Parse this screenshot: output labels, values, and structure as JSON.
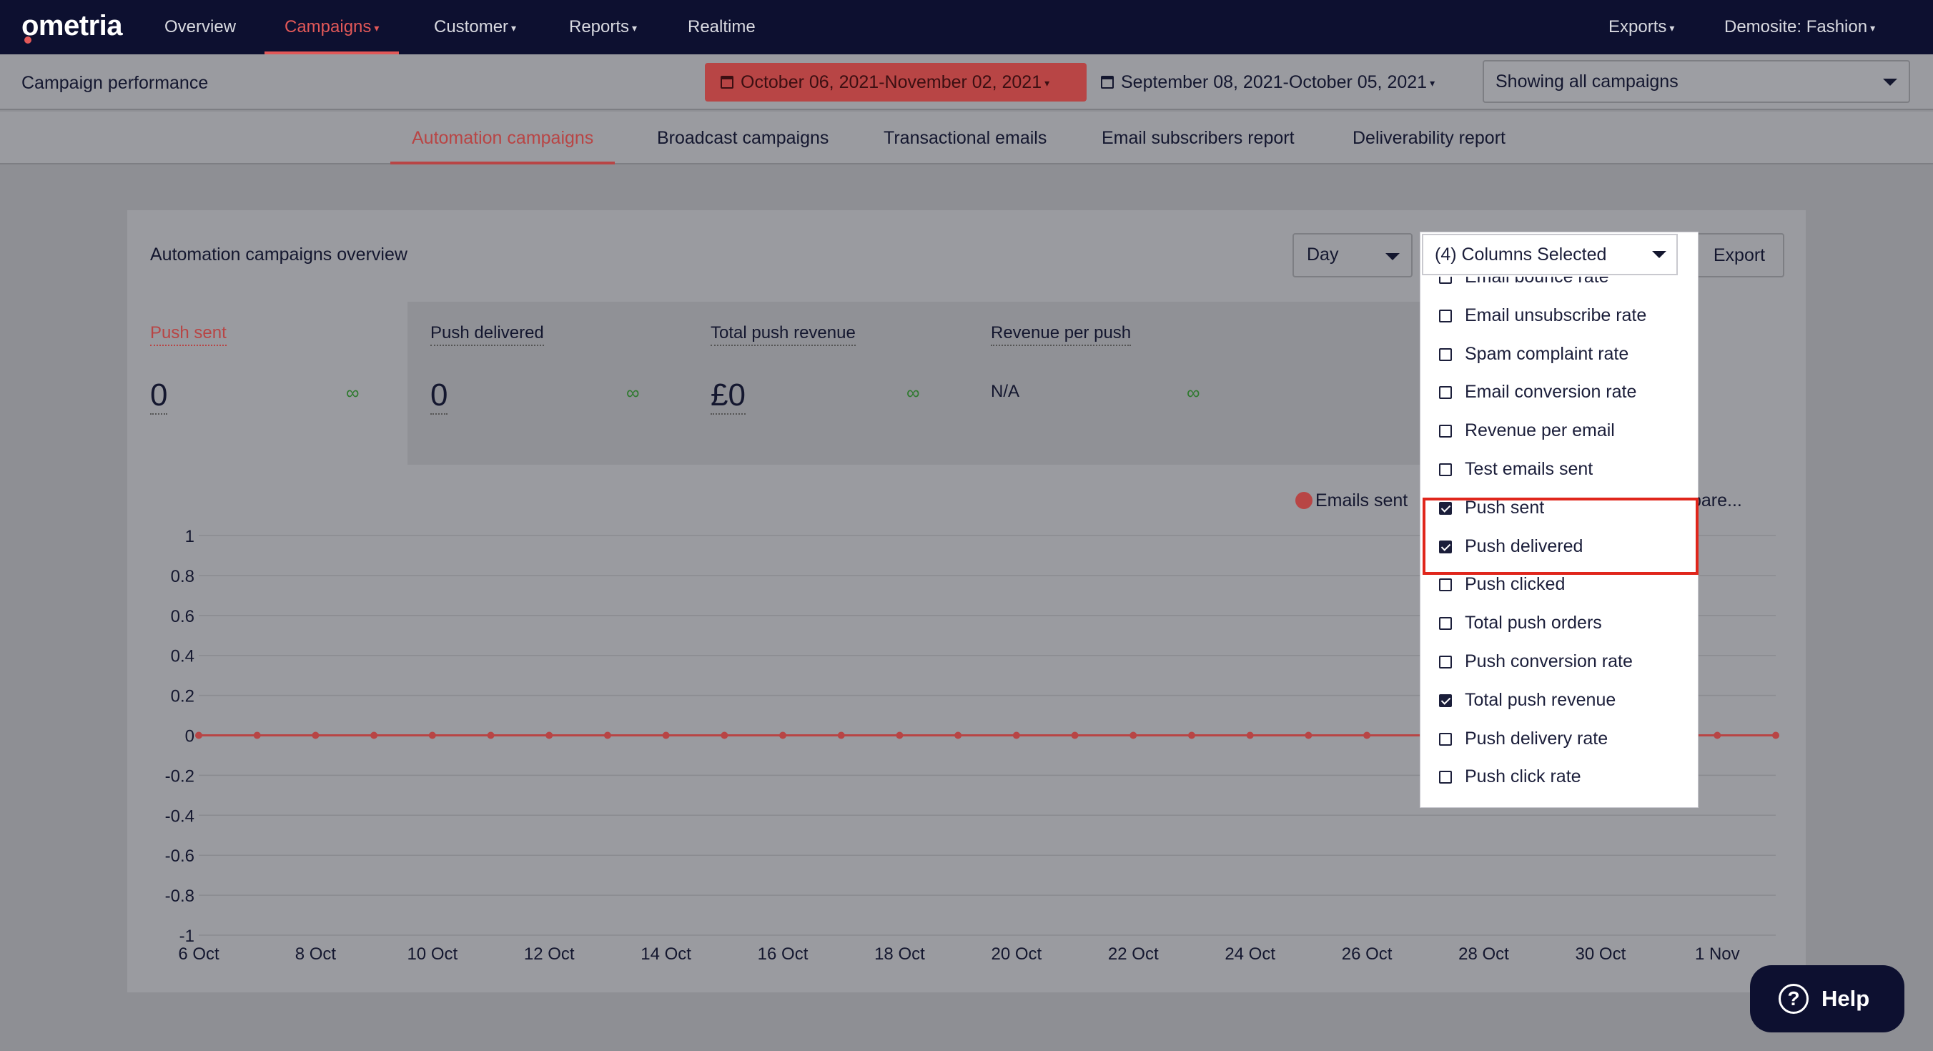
{
  "nav": {
    "logo": "ometria",
    "items": [
      {
        "label": "Overview"
      },
      {
        "label": "Campaigns"
      },
      {
        "label": "Customer"
      },
      {
        "label": "Reports"
      },
      {
        "label": "Realtime"
      }
    ],
    "right": [
      {
        "label": "Exports"
      },
      {
        "label": "Demosite: Fashion"
      }
    ]
  },
  "header": {
    "title": "Campaign performance",
    "date_range": "October 06, 2021-November 02, 2021",
    "compare_range": "September 08, 2021-October 05, 2021",
    "campaign_filter": "Showing all campaigns"
  },
  "tabs": [
    {
      "label": "Automation campaigns",
      "active": true
    },
    {
      "label": "Broadcast campaigns"
    },
    {
      "label": "Transactional emails"
    },
    {
      "label": "Email subscribers report"
    },
    {
      "label": "Deliverability report"
    }
  ],
  "overview": {
    "title": "Automation campaigns overview",
    "interval": "Day",
    "export_label": "Export",
    "metrics": [
      {
        "label": "Push sent",
        "value": "0",
        "change": "∞"
      },
      {
        "label": "Push delivered",
        "value": "0",
        "change": "∞"
      },
      {
        "label": "Total push revenue",
        "value": "£0",
        "change": "∞"
      },
      {
        "label": "Revenue per push",
        "value": "N/A",
        "change": "∞"
      }
    ],
    "legend": {
      "primary": "Emails sent",
      "secondary": "pare..."
    }
  },
  "columns_dropdown": {
    "header": "(4) Columns Selected",
    "items": [
      {
        "label": "Email bounce rate",
        "checked": false
      },
      {
        "label": "Email unsubscribe rate",
        "checked": false
      },
      {
        "label": "Spam complaint rate",
        "checked": false
      },
      {
        "label": "Email conversion rate",
        "checked": false
      },
      {
        "label": "Revenue per email",
        "checked": false
      },
      {
        "label": "Test emails sent",
        "checked": false
      },
      {
        "label": "Push sent",
        "checked": true
      },
      {
        "label": "Push delivered",
        "checked": true
      },
      {
        "label": "Push clicked",
        "checked": false
      },
      {
        "label": "Total push orders",
        "checked": false
      },
      {
        "label": "Push conversion rate",
        "checked": false
      },
      {
        "label": "Total push revenue",
        "checked": true
      },
      {
        "label": "Push delivery rate",
        "checked": false
      },
      {
        "label": "Push click rate",
        "checked": false
      }
    ]
  },
  "help": {
    "label": "Help"
  },
  "colors": {
    "accent": "#e25858",
    "nav_bg": "#0d1030",
    "highlight": "#e0261c"
  },
  "chart_data": {
    "type": "line",
    "ylim": [
      -1,
      1
    ],
    "y_ticks": [
      "1",
      "0.8",
      "0.6",
      "0.4",
      "0.2",
      "0",
      "-0.2",
      "-0.4",
      "-0.6",
      "-0.8",
      "-1"
    ],
    "x_tick_labels": [
      "6 Oct",
      "8 Oct",
      "10 Oct",
      "12 Oct",
      "14 Oct",
      "16 Oct",
      "18 Oct",
      "20 Oct",
      "22 Oct",
      "24 Oct",
      "26 Oct",
      "28 Oct",
      "30 Oct",
      "1 Nov"
    ],
    "x": [
      "6 Oct",
      "7 Oct",
      "8 Oct",
      "9 Oct",
      "10 Oct",
      "11 Oct",
      "12 Oct",
      "13 Oct",
      "14 Oct",
      "15 Oct",
      "16 Oct",
      "17 Oct",
      "18 Oct",
      "19 Oct",
      "20 Oct",
      "21 Oct",
      "22 Oct",
      "23 Oct",
      "24 Oct",
      "25 Oct",
      "26 Oct",
      "27 Oct",
      "28 Oct",
      "29 Oct",
      "30 Oct",
      "31 Oct",
      "1 Nov",
      "2 Nov"
    ],
    "series": [
      {
        "name": "Emails sent",
        "color": "#b84545",
        "values": [
          0,
          0,
          0,
          0,
          0,
          0,
          0,
          0,
          0,
          0,
          0,
          0,
          0,
          0,
          0,
          0,
          0,
          0,
          0,
          0,
          0,
          0,
          0,
          0,
          0,
          0,
          0,
          0
        ]
      }
    ],
    "grid": true
  }
}
